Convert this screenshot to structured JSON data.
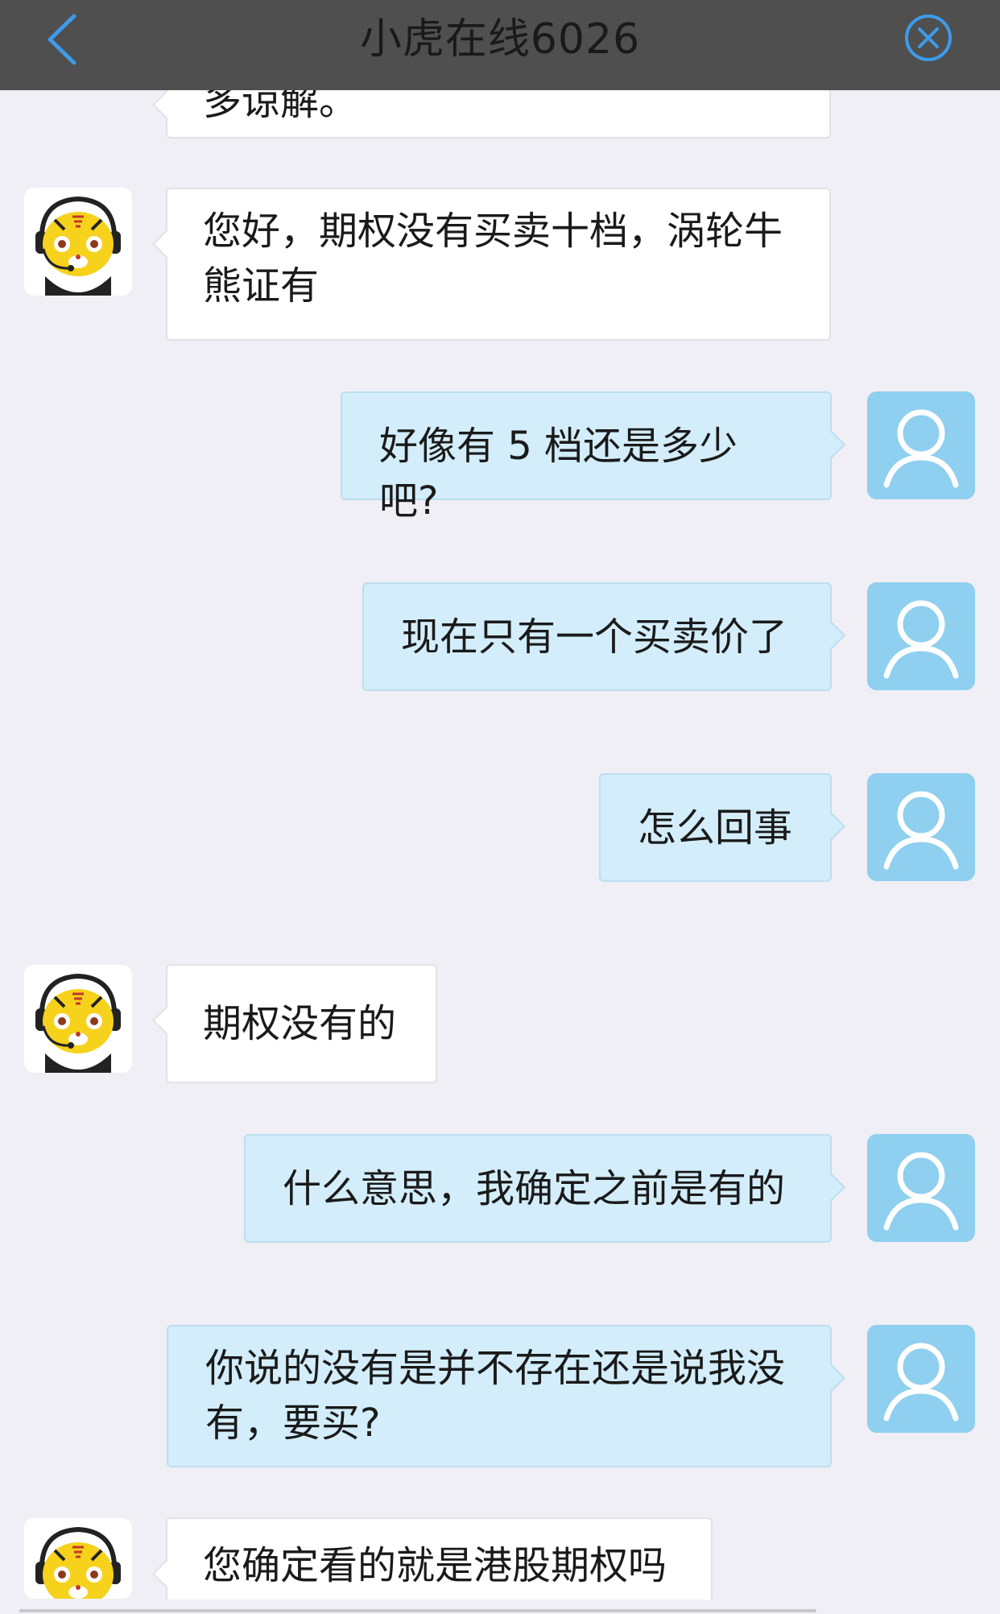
{
  "header": {
    "title": "小虎在线6026"
  },
  "messages": [
    {
      "sender": "agent",
      "text": "多谅解。"
    },
    {
      "sender": "agent",
      "text": "您好，期权没有买卖十档，涡轮牛熊证有"
    },
    {
      "sender": "user",
      "text": "好像有 5 档还是多少吧?"
    },
    {
      "sender": "user",
      "text": "现在只有一个买卖价了"
    },
    {
      "sender": "user",
      "text": "怎么回事"
    },
    {
      "sender": "agent",
      "text": "期权没有的"
    },
    {
      "sender": "user",
      "text": "什么意思，我确定之前是有的"
    },
    {
      "sender": "user",
      "text": "你说的没有是并不存在还是说我没有，要买?"
    },
    {
      "sender": "agent",
      "text": "您确定看的就是港股期权吗"
    }
  ],
  "colors": {
    "header_bg": "#4f4f4f",
    "accent_blue": "#3d9be9",
    "user_bubble": "#d3edfa",
    "user_avatar": "#8fcff0",
    "page_bg": "#f0eff5"
  },
  "icons": {
    "back": "chevron-left-icon",
    "close": "close-circle-icon",
    "user_avatar": "person-icon",
    "agent_avatar": "tiger-mascot-icon"
  }
}
